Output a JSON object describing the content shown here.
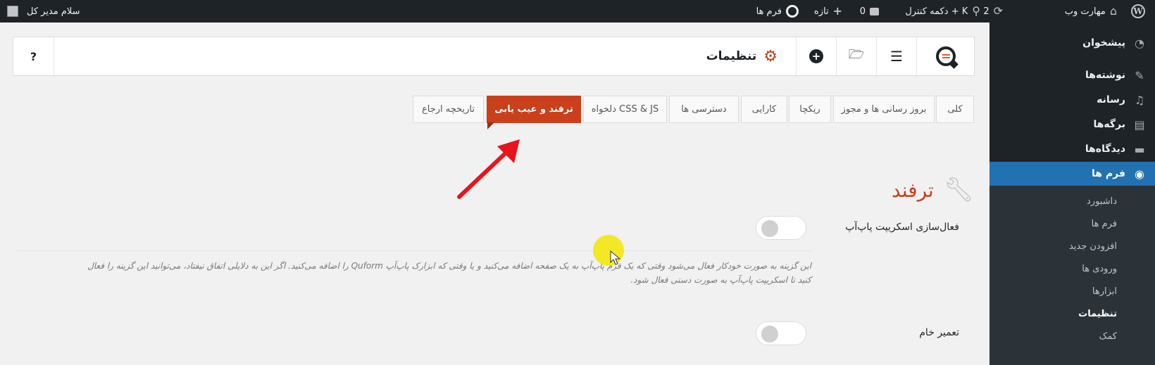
{
  "admin_bar": {
    "site_name": "مهارت وب",
    "updates_count": "2",
    "keyboard_shortcut": "دکمه کنترل + K",
    "comments_count": "0",
    "new_label": "تازه",
    "forms_label": "فرم ها",
    "greeting": "سلام مدیر کل"
  },
  "sidebar": {
    "items": [
      {
        "label": "پیشخوان",
        "icon": "dashboard-icon"
      },
      {
        "label": "نوشته‌ها",
        "icon": "pin-icon"
      },
      {
        "label": "رسانه",
        "icon": "media-icon"
      },
      {
        "label": "برگه‌ها",
        "icon": "pages-icon"
      },
      {
        "label": "دیدگاه‌ها",
        "icon": "comments-icon"
      },
      {
        "label": "فرم ها",
        "icon": "quform-icon",
        "active": true
      }
    ],
    "submenu": [
      "داشبورد",
      "فرم ها",
      "افزودن جدید",
      "ورودی ها",
      "ابزارها",
      "تنظیمات",
      "کمک"
    ],
    "current_submenu": "تنظیمات"
  },
  "toolbar": {
    "title": "تنظیمات",
    "help": "?"
  },
  "tabs": [
    {
      "label": "کلی"
    },
    {
      "label": "بروز رسانی ها و مجوز"
    },
    {
      "label": "ریکچا"
    },
    {
      "label": "کارایی"
    },
    {
      "label": "دسترسی ها"
    },
    {
      "label": "CSS & JS دلخواه"
    },
    {
      "label": "ترفند و عیب یابی",
      "active": true
    },
    {
      "label": "تاریخچه ارجاع"
    }
  ],
  "section": {
    "title": "ترفند",
    "options": [
      {
        "label": "فعال‌سازی اسکریپت پاپ‌آپ",
        "enabled": false,
        "description_line1": "این گزینه به صورت خودکار فعال می‌شود وقتی که یک فرم پاپ‌آپ به یک صفحه اضافه می‌کنید و یا وقتی که ابزارک پاپ‌آپ Quform را اضافه می‌کنید. اگر این به دلایلی اتفاق نیفتاد، می‌توانید این گزینه را فعال",
        "description_line2": "کنید تا اسکریپت پاپ‌آپ به صورت دستی فعال شود."
      },
      {
        "label": "تعمیر خام",
        "enabled": false
      }
    ]
  },
  "colors": {
    "accent": "#c9401b",
    "sidebar_bg": "#1d2327",
    "sidebar_active": "#2271b1",
    "annotation_arrow": "#e8141c",
    "highlight": "#f3e600"
  }
}
